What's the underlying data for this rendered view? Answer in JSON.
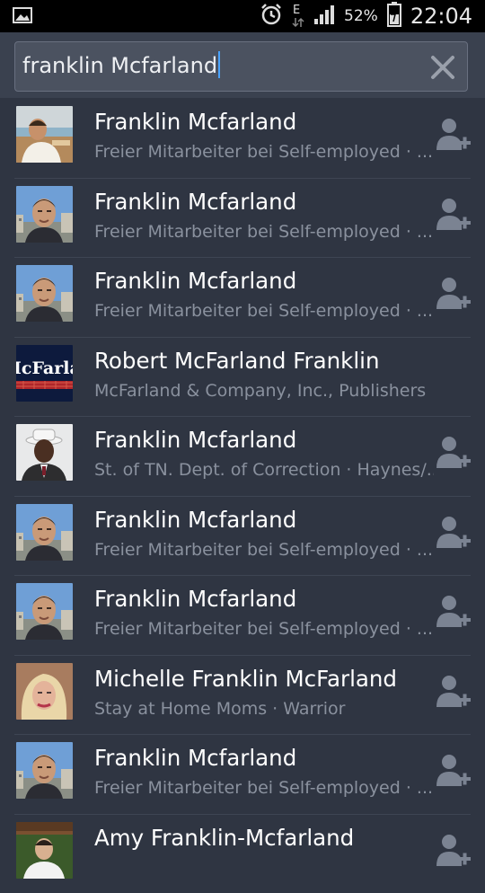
{
  "status_bar": {
    "battery": "52%",
    "time": "22:04",
    "network": "E"
  },
  "search": {
    "query": "franklin Mcfarland"
  },
  "results": [
    {
      "name": "Franklin Mcfarland",
      "subtitle": "Freier Mitarbeiter bei Self-employed · ...",
      "avatar": "beach-photo",
      "can_add": true
    },
    {
      "name": "Franklin Mcfarland",
      "subtitle": "Freier Mitarbeiter bei Self-employed · ...",
      "avatar": "city-photo",
      "can_add": true
    },
    {
      "name": "Franklin Mcfarland",
      "subtitle": "Freier Mitarbeiter bei Self-employed · ...",
      "avatar": "city-photo",
      "can_add": true
    },
    {
      "name": "Robert McFarland Franklin",
      "subtitle": "McFarland & Company, Inc., Publishers",
      "avatar": "logo",
      "logo_text": "IcFarla",
      "can_add": false
    },
    {
      "name": "Franklin Mcfarland",
      "subtitle": "St. of TN. Dept. of Correction · Haynes/...",
      "avatar": "hat-photo",
      "can_add": true
    },
    {
      "name": "Franklin Mcfarland",
      "subtitle": "Freier Mitarbeiter bei Self-employed · ...",
      "avatar": "city-photo",
      "can_add": true
    },
    {
      "name": "Franklin Mcfarland",
      "subtitle": "Freier Mitarbeiter bei Self-employed · ...",
      "avatar": "city-photo",
      "can_add": true
    },
    {
      "name": "Michelle Franklin McFarland",
      "subtitle": "Stay at Home Moms · Warrior",
      "avatar": "blonde-photo",
      "can_add": true
    },
    {
      "name": "Franklin Mcfarland",
      "subtitle": "Freier Mitarbeiter bei Self-employed · ...",
      "avatar": "city-photo",
      "can_add": true
    },
    {
      "name": "Amy Franklin-Mcfarland",
      "subtitle": "",
      "avatar": "garden-photo",
      "can_add": true
    }
  ],
  "colors": {
    "background": "#2f3542",
    "header": "#3a414f",
    "accent": "#4aa3ff",
    "subtitle": "#8a919e",
    "add_icon": "#7b8392"
  }
}
